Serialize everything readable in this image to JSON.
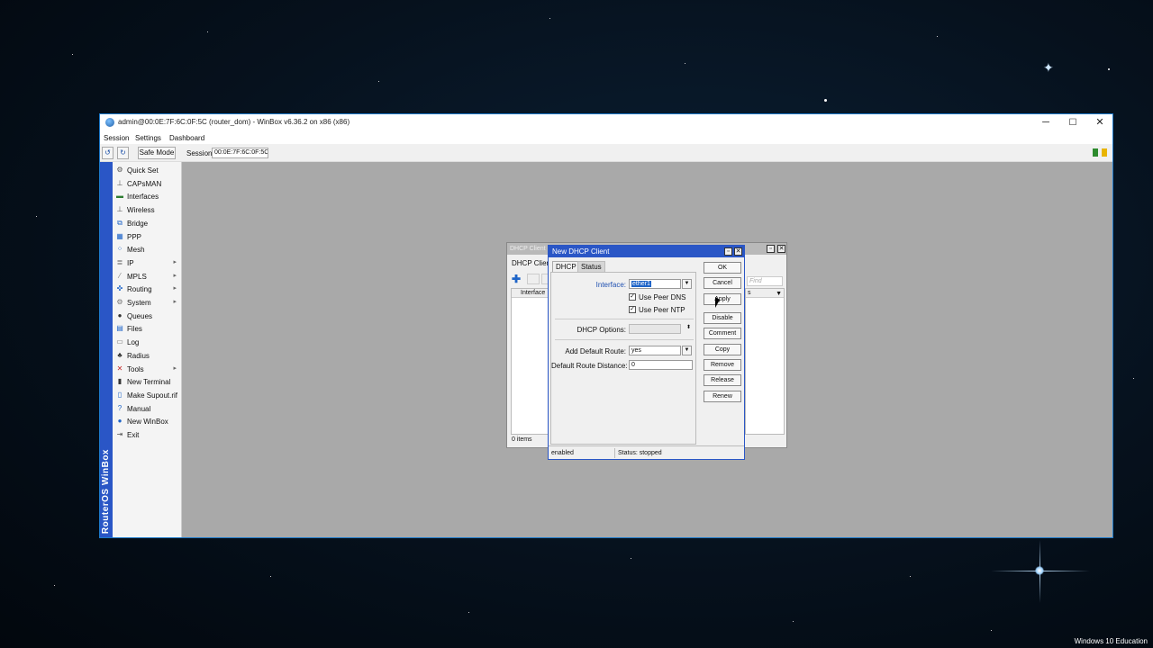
{
  "desktop": {
    "watermark": "Windows 10 Education"
  },
  "window": {
    "title": "admin@00:0E:7F:6C:0F:5C (router_dom) - WinBox v6.36.2 on x86 (x86)",
    "controls": {
      "minimize": "─",
      "maximize": "☐",
      "close": "✕"
    }
  },
  "menu": {
    "session": "Session",
    "settings": "Settings",
    "dashboard": "Dashboard"
  },
  "toolbar": {
    "undo": "↺",
    "redo": "↻",
    "safe_mode": "Safe Mode",
    "session_label": "Session:",
    "session_value": "00:0E:7F:6C:0F:5C"
  },
  "brand_vertical": "RouterOS WinBox",
  "sidebar": {
    "items": [
      {
        "label": "Quick Set",
        "icon": "quick-set-icon",
        "arrow": false
      },
      {
        "label": "CAPsMAN",
        "icon": "capsman-icon",
        "arrow": false
      },
      {
        "label": "Interfaces",
        "icon": "interfaces-icon",
        "arrow": false
      },
      {
        "label": "Wireless",
        "icon": "wireless-icon",
        "arrow": false
      },
      {
        "label": "Bridge",
        "icon": "bridge-icon",
        "arrow": false
      },
      {
        "label": "PPP",
        "icon": "ppp-icon",
        "arrow": false
      },
      {
        "label": "Mesh",
        "icon": "mesh-icon",
        "arrow": false
      },
      {
        "label": "IP",
        "icon": "ip-icon",
        "arrow": true
      },
      {
        "label": "MPLS",
        "icon": "mpls-icon",
        "arrow": true
      },
      {
        "label": "Routing",
        "icon": "routing-icon",
        "arrow": true
      },
      {
        "label": "System",
        "icon": "system-icon",
        "arrow": true
      },
      {
        "label": "Queues",
        "icon": "queues-icon",
        "arrow": false
      },
      {
        "label": "Files",
        "icon": "files-icon",
        "arrow": false
      },
      {
        "label": "Log",
        "icon": "log-icon",
        "arrow": false
      },
      {
        "label": "Radius",
        "icon": "radius-icon",
        "arrow": false
      },
      {
        "label": "Tools",
        "icon": "tools-icon",
        "arrow": true
      },
      {
        "label": "New Terminal",
        "icon": "terminal-icon",
        "arrow": false
      },
      {
        "label": "Make Supout.rif",
        "icon": "supout-icon",
        "arrow": false
      },
      {
        "label": "Manual",
        "icon": "manual-icon",
        "arrow": false
      },
      {
        "label": "New WinBox",
        "icon": "winbox-icon",
        "arrow": false
      },
      {
        "label": "Exit",
        "icon": "exit-icon",
        "arrow": false
      }
    ]
  },
  "back_window": {
    "title": "DHCP Client",
    "tab": "DHCP Client",
    "column": "Interface",
    "right_column": "s",
    "find_placeholder": "Find",
    "items_count": "0 items"
  },
  "dialog": {
    "title": "New DHCP Client",
    "tabs": [
      "DHCP",
      "Status"
    ],
    "fields": {
      "interface_label": "Interface:",
      "interface_value": "ether1",
      "use_peer_dns": "Use Peer DNS",
      "use_peer_ntp": "Use Peer NTP",
      "dhcp_options_label": "DHCP Options:",
      "add_default_route_label": "Add Default Route:",
      "add_default_route_value": "yes",
      "default_route_distance_label": "Default Route Distance:",
      "default_route_distance_value": "0"
    },
    "buttons": [
      "OK",
      "Cancel",
      "Apply",
      "Disable",
      "Comment",
      "Copy",
      "Remove",
      "Release",
      "Renew"
    ],
    "status_left": "enabled",
    "status_right": "Status: stopped"
  }
}
